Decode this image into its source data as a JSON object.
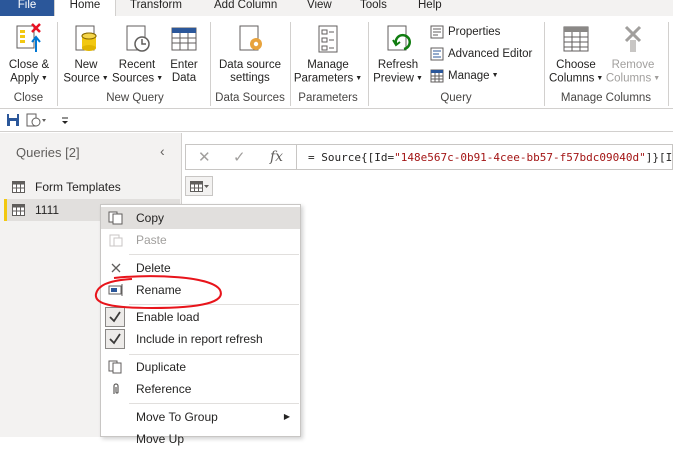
{
  "tabs": [
    "File",
    "Home",
    "Transform",
    "Add Column",
    "View",
    "Tools",
    "Help"
  ],
  "ribbon": {
    "close_apply": [
      "Close &",
      "Apply"
    ],
    "new_source": [
      "New",
      "Source"
    ],
    "recent_sources": [
      "Recent",
      "Sources"
    ],
    "enter_data": [
      "Enter",
      "Data"
    ],
    "data_source_settings": [
      "Data source",
      "settings"
    ],
    "manage_parameters": [
      "Manage",
      "Parameters"
    ],
    "refresh_preview": [
      "Refresh",
      "Preview"
    ],
    "properties": "Properties",
    "advanced_editor": "Advanced Editor",
    "manage": "Manage",
    "choose_columns": [
      "Choose",
      "Columns"
    ],
    "remove_columns": [
      "Remove",
      "Columns"
    ],
    "groups": {
      "close": "Close",
      "new_query": "New Query",
      "data_sources": "Data Sources",
      "parameters": "Parameters",
      "query": "Query",
      "manage_columns": "Manage Columns"
    }
  },
  "queries_pane": {
    "title": "Queries [2]",
    "items": [
      "Form Templates",
      "1111"
    ]
  },
  "formula_bar": {
    "prefix": "= Source{[Id=",
    "string": "\"148e567c-0b91-4cee-bb57-f57bdc09040d\"",
    "suffix": "]}[It"
  },
  "context_menu": {
    "copy": "Copy",
    "paste": "Paste",
    "delete": "Delete",
    "rename": "Rename",
    "enable_load": "Enable load",
    "include_refresh": "Include in report refresh",
    "duplicate": "Duplicate",
    "reference": "Reference",
    "move_to_group": "Move To Group",
    "partial_next": "Move Up"
  },
  "colors": {
    "file_tab": "#2b579a",
    "accent_yellow": "#f2c811",
    "annotation_red": "#e8141b",
    "string_red": "#a31515"
  }
}
